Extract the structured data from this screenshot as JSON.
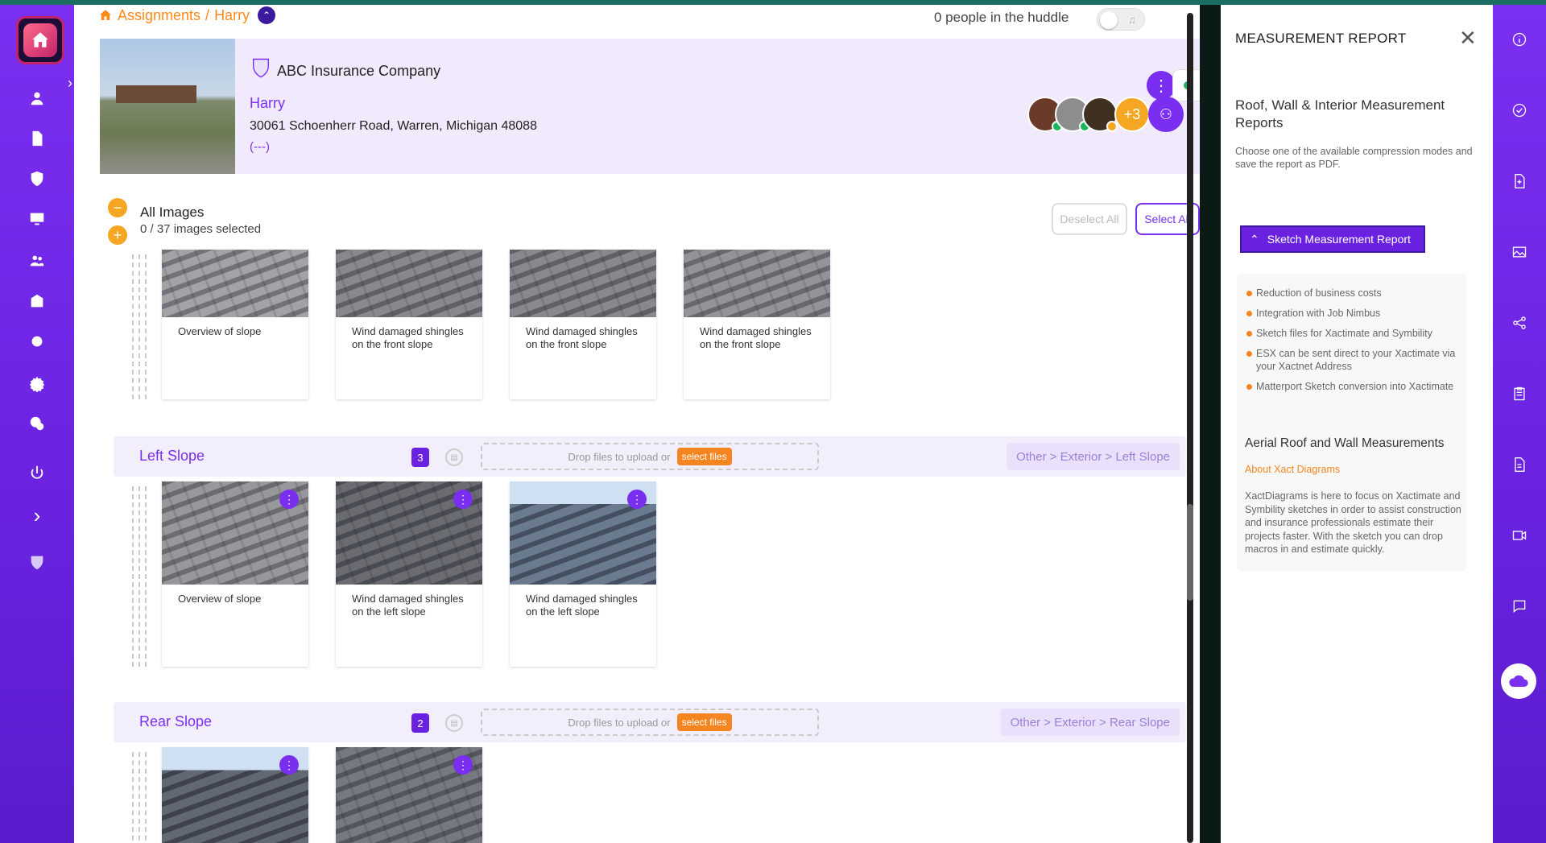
{
  "breadcrumb": {
    "parent": "Assignments",
    "separator": "/",
    "current": "Harry"
  },
  "huddle": {
    "text": "0 people in the huddle"
  },
  "header": {
    "company": "ABC Insurance Company",
    "name": "Harry",
    "address": "30061 Schoenherr Road, Warren, Michigan 48088",
    "phone": "(---)",
    "extra_people": "+3"
  },
  "images": {
    "title": "All Images",
    "count_text": "0 / 37 images selected",
    "deselect_label": "Deselect All",
    "select_label": "Select All",
    "top_cards": [
      {
        "caption": "Overview of slope"
      },
      {
        "caption": "Wind damaged shingles on the front slope"
      },
      {
        "caption": "Wind damaged shingles on the front slope"
      },
      {
        "caption": "Wind damaged shingles on the front slope"
      }
    ]
  },
  "sections": [
    {
      "title": "Left Slope",
      "count": "3",
      "drop_text": "Drop files to upload or",
      "select_files": "select files",
      "path": "Other > Exterior > Left Slope",
      "cards": [
        {
          "caption": "Overview of slope"
        },
        {
          "caption": "Wind damaged shingles on the left slope"
        },
        {
          "caption": "Wind damaged shingles on the left slope"
        }
      ]
    },
    {
      "title": "Rear Slope",
      "count": "2",
      "drop_text": "Drop files to upload or",
      "select_files": "select files",
      "path": "Other > Exterior > Rear Slope",
      "cards": [
        {
          "caption": ""
        },
        {
          "caption": ""
        }
      ]
    }
  ],
  "panel": {
    "title": "MEASUREMENT REPORT",
    "heading": "Roof, Wall & Interior Measurement Reports",
    "description": "Choose one of the available compression modes and save the report as PDF.",
    "button_label": "Sketch Measurement Report",
    "features": [
      "Reduction of business costs",
      "Integration with Job Nimbus",
      "Sketch files for Xactimate and Symbility",
      "ESX can be sent direct to your Xactimate via your Xactnet Address",
      "Matterport Sketch conversion into Xactimate"
    ],
    "sub_heading": "Aerial Roof and Wall Measurements",
    "link": "About Xact Diagrams",
    "paragraph": "XactDiagrams is here to focus on Xactimate and Symbility sketches in order to assist construction and insurance professionals estimate their projects faster. With the sketch you can drop macros in and estimate quickly."
  },
  "colors": {
    "brand_purple": "#7a2ff0",
    "accent_orange": "#f5851f",
    "online_green": "#18b85a"
  }
}
